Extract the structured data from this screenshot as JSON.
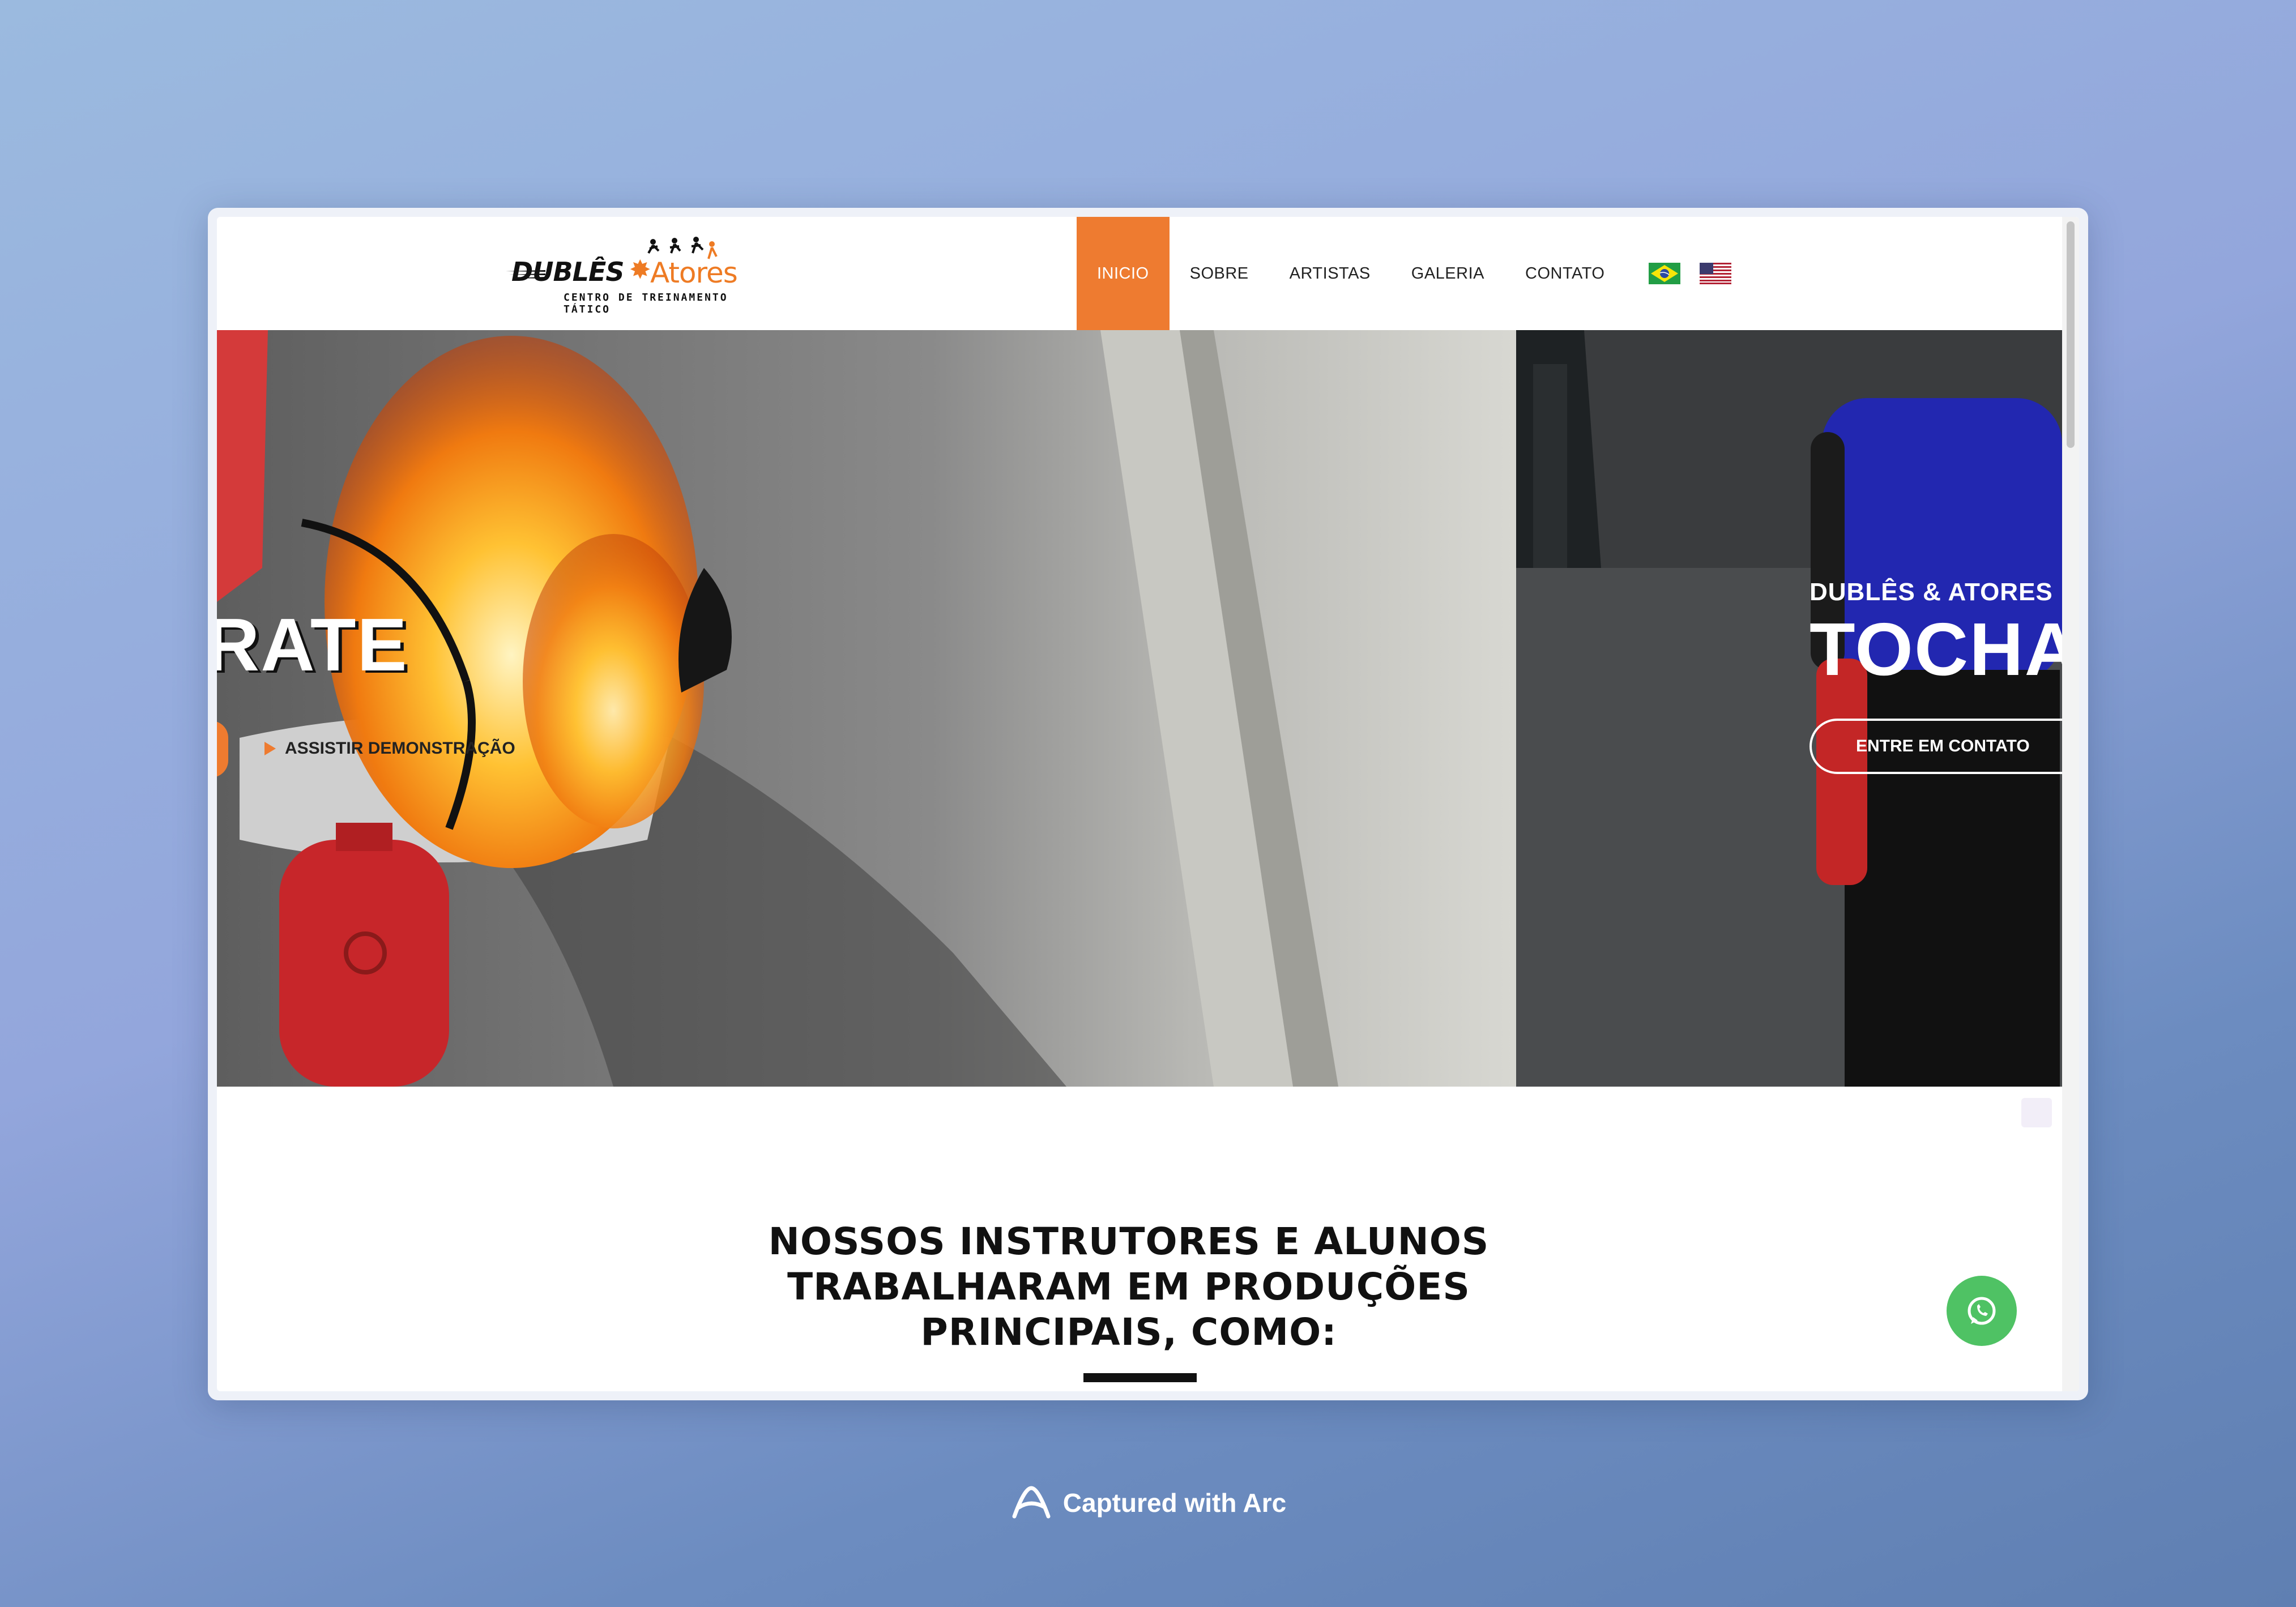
{
  "logo": {
    "brand_left": "DUBLÊS",
    "brand_right": "Atores",
    "tagline": "CENTRO DE TREINAMENTO TÁTICO"
  },
  "nav": {
    "items": [
      {
        "label": "INICIO",
        "active": true
      },
      {
        "label": "SOBRE"
      },
      {
        "label": "ARTISTAS"
      },
      {
        "label": "GALERIA"
      },
      {
        "label": "CONTATO"
      }
    ],
    "flags": [
      "brazil-flag-icon",
      "usa-flag-icon"
    ],
    "active_color": "#ee7b30"
  },
  "hero": {
    "left_title_partial": "RATE",
    "left_play_label": "ASSISTIR DEMONSTRAÇÃO",
    "right_kicker": "DUBLÊS & ATORES",
    "right_title_partial": "TOCHA",
    "right_cta_label": "ENTRE EM CONTATO"
  },
  "section": {
    "title": "NOSSOS INSTRUTORES E ALUNOS TRABALHARAM EM PRODUÇÕES PRINCIPAIS, COMO:"
  },
  "footer": {
    "caption": "Captured with Arc"
  },
  "colors": {
    "accent": "#ee7b30",
    "whatsapp": "#4fc264"
  }
}
